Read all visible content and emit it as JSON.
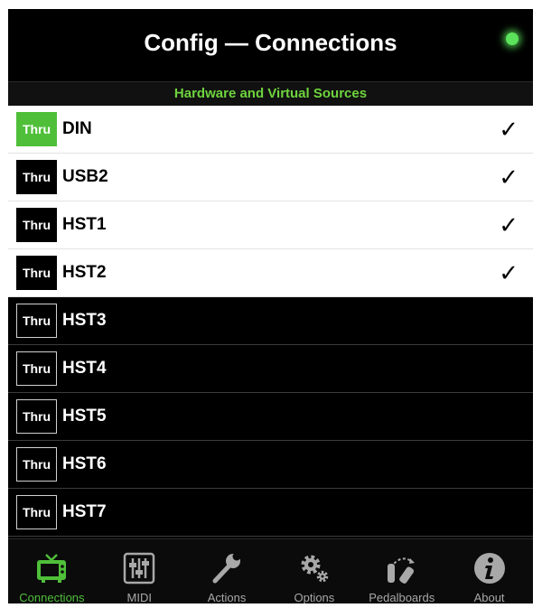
{
  "header": {
    "title": "Config — Connections",
    "status": "connected"
  },
  "section": {
    "label": "Hardware and Virtual Sources"
  },
  "rows": [
    {
      "thru": "Thru",
      "name": "DIN",
      "checked": "✓",
      "thru_active": true,
      "enabled": true
    },
    {
      "thru": "Thru",
      "name": "USB2",
      "checked": "✓",
      "thru_active": false,
      "enabled": true
    },
    {
      "thru": "Thru",
      "name": "HST1",
      "checked": "✓",
      "thru_active": false,
      "enabled": true
    },
    {
      "thru": "Thru",
      "name": "HST2",
      "checked": "✓",
      "thru_active": false,
      "enabled": true
    },
    {
      "thru": "Thru",
      "name": "HST3",
      "checked": "",
      "thru_active": false,
      "enabled": false
    },
    {
      "thru": "Thru",
      "name": "HST4",
      "checked": "",
      "thru_active": false,
      "enabled": false
    },
    {
      "thru": "Thru",
      "name": "HST5",
      "checked": "",
      "thru_active": false,
      "enabled": false
    },
    {
      "thru": "Thru",
      "name": "HST6",
      "checked": "",
      "thru_active": false,
      "enabled": false
    },
    {
      "thru": "Thru",
      "name": "HST7",
      "checked": "",
      "thru_active": false,
      "enabled": false
    }
  ],
  "tabs": [
    {
      "label": "Connections",
      "icon": "tv-icon",
      "active": true
    },
    {
      "label": "MIDI",
      "icon": "mixer-sliders-icon",
      "active": false
    },
    {
      "label": "Actions",
      "icon": "wrench-icon",
      "active": false
    },
    {
      "label": "Options",
      "icon": "gears-icon",
      "active": false
    },
    {
      "label": "Pedalboards",
      "icon": "pedalboard-icon",
      "active": false
    },
    {
      "label": "About",
      "icon": "info-icon",
      "active": false
    }
  ],
  "colors": {
    "accent": "#4fbf3a",
    "led": "#5be35b",
    "section_text": "#6ed43e",
    "tab_inactive": "#a8a8a8"
  }
}
